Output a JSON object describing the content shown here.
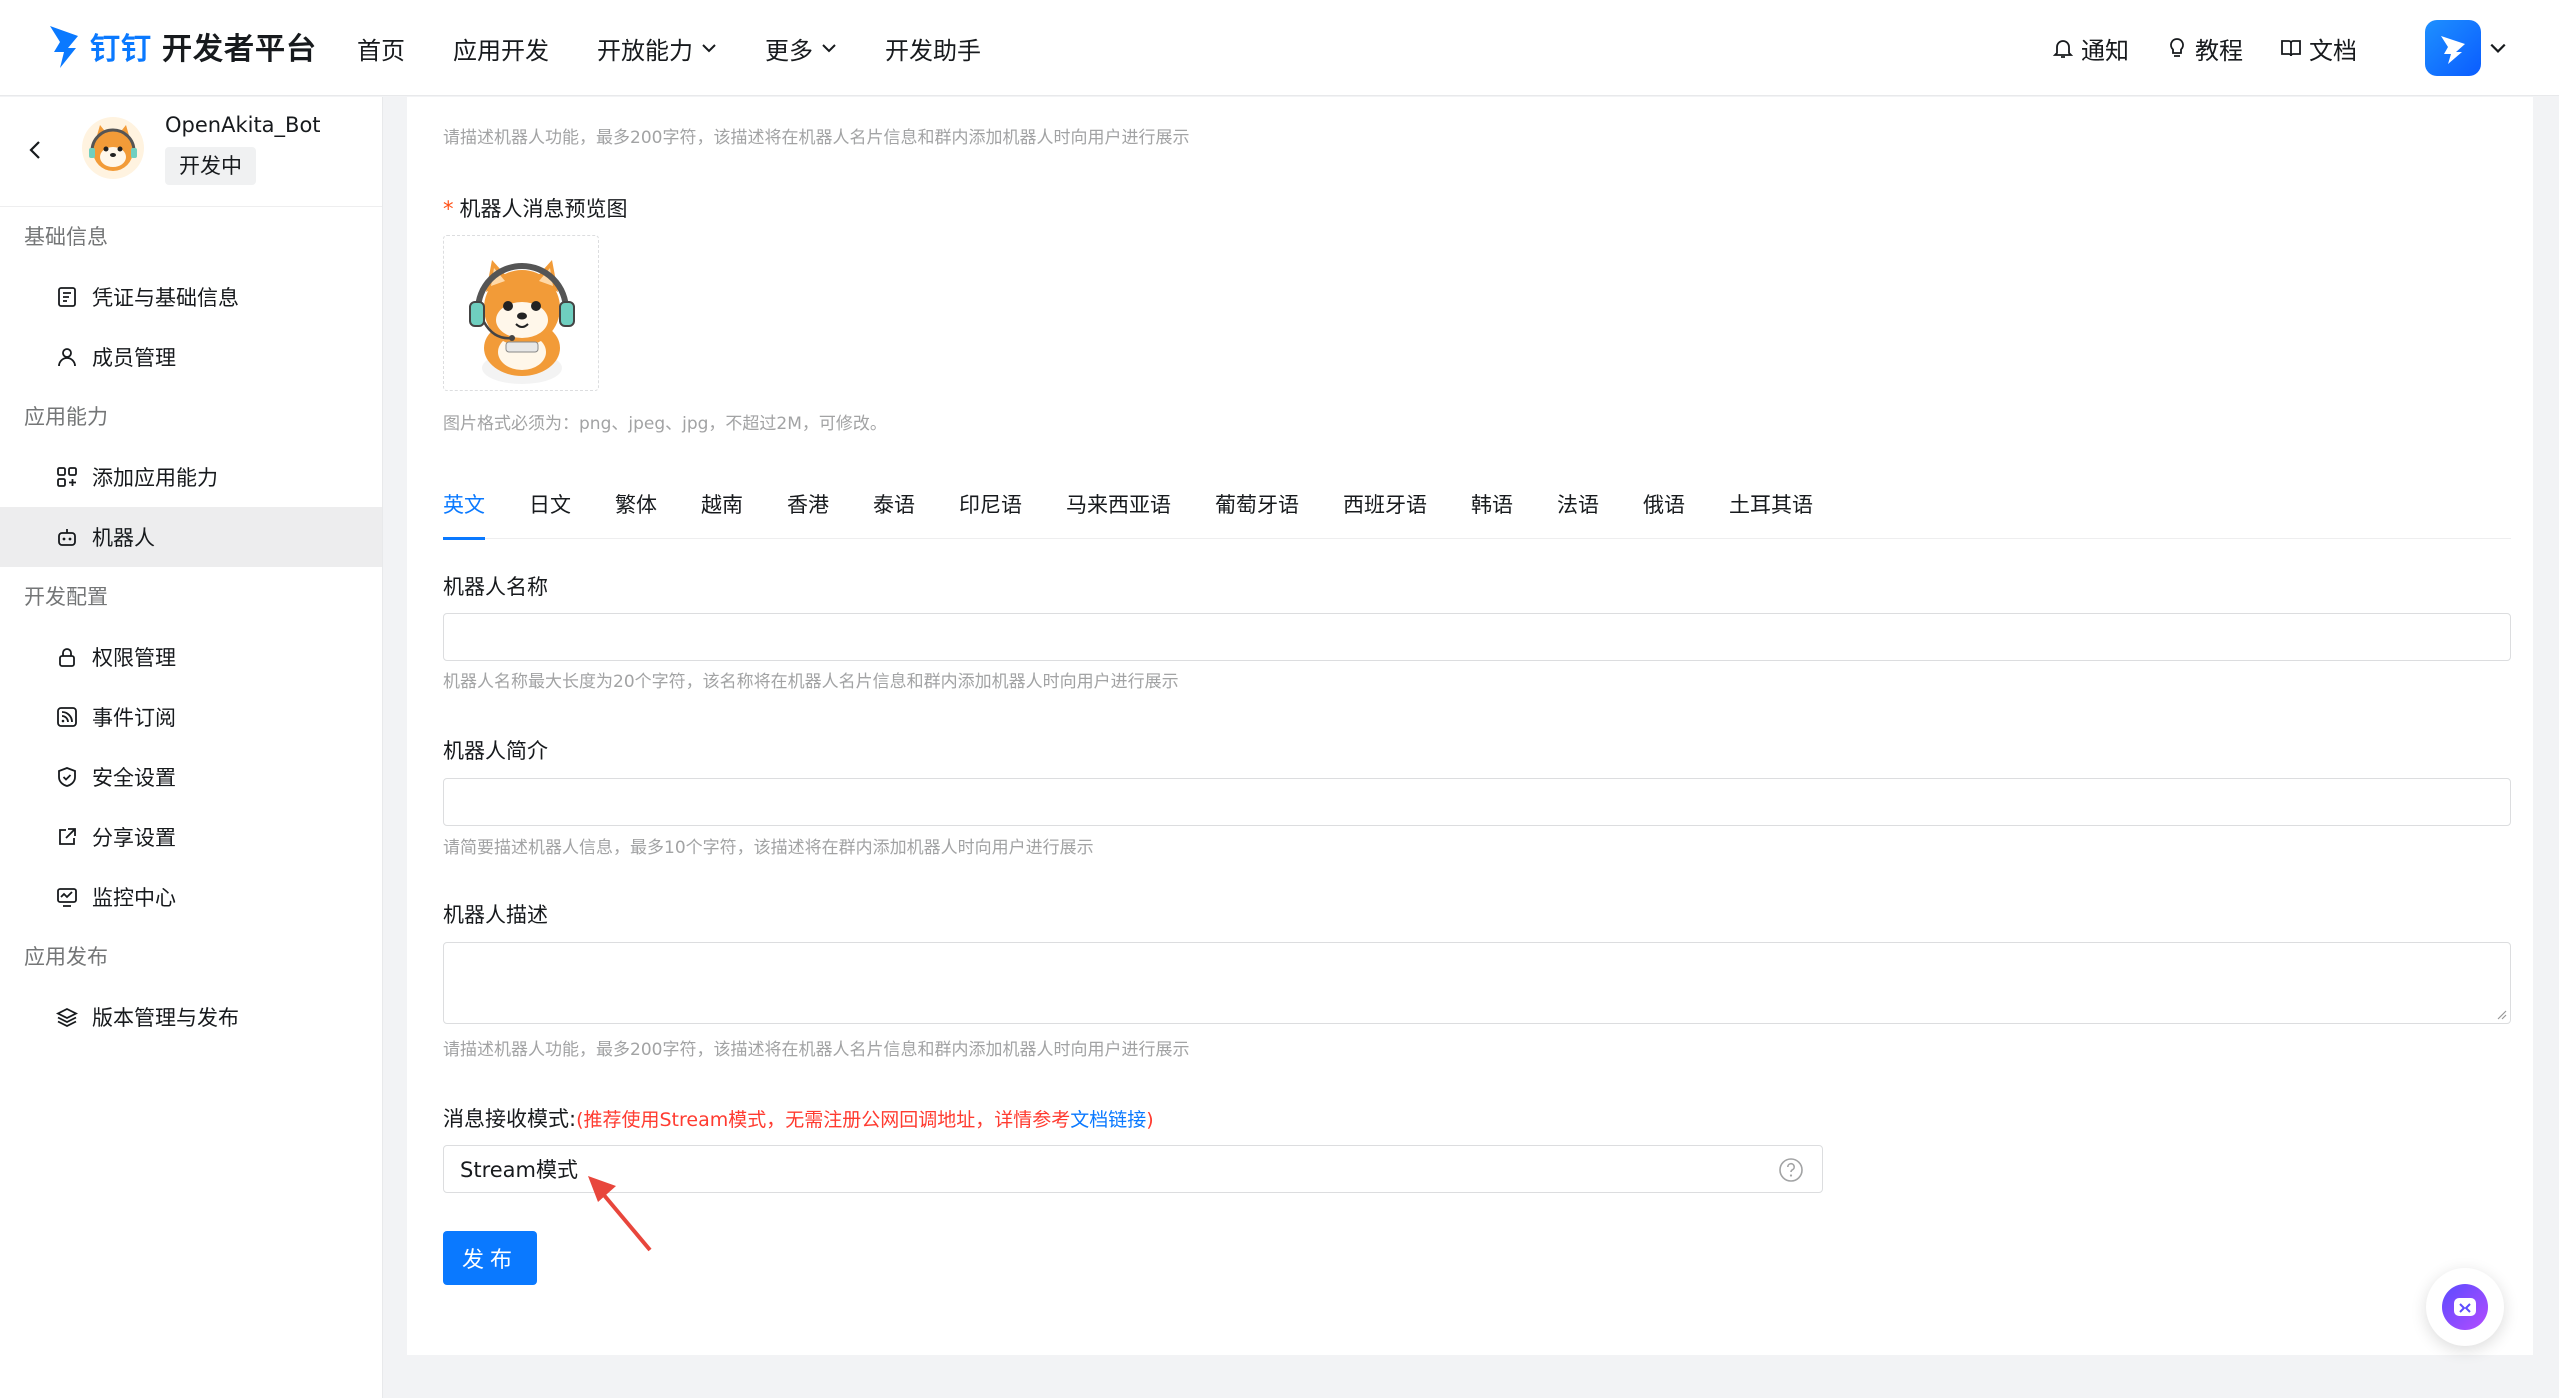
{
  "header": {
    "brand": "钉钉",
    "brand_sub": "开发者平台",
    "nav": [
      "首页",
      "应用开发",
      "开放能力",
      "更多",
      "开发助手"
    ],
    "right": {
      "notify": "通知",
      "tutorial": "教程",
      "docs": "文档"
    }
  },
  "sidebar": {
    "app_name": "OpenAkita_Bot",
    "app_status": "开发中",
    "groups": {
      "basic": "基础信息",
      "ability": "应用能力",
      "dev": "开发配置",
      "release": "应用发布"
    },
    "items": {
      "credentials": "凭证与基础信息",
      "members": "成员管理",
      "add_ability": "添加应用能力",
      "robot": "机器人",
      "permissions": "权限管理",
      "events": "事件订阅",
      "security": "安全设置",
      "share": "分享设置",
      "monitor": "监控中心",
      "versions": "版本管理与发布"
    }
  },
  "main": {
    "top_hint": "请描述机器人功能，最多200字符，该描述将在机器人名片信息和群内添加机器人时向用户进行展示",
    "preview_label": "机器人消息预览图",
    "preview_hint": "图片格式必须为：png、jpeg、jpg，不超过2M，可修改。",
    "tabs": [
      "英文",
      "日文",
      "繁体",
      "越南",
      "香港",
      "泰语",
      "印尼语",
      "马来西亚语",
      "葡萄牙语",
      "西班牙语",
      "韩语",
      "法语",
      "俄语",
      "土耳其语"
    ],
    "name_label": "机器人名称",
    "name_value": "",
    "name_hint": "机器人名称最大长度为20个字符，该名称将在机器人名片信息和群内添加机器人时向用户进行展示",
    "intro_label": "机器人简介",
    "intro_value": "",
    "intro_hint": "请简要描述机器人信息，最多10个字符，该描述将在群内添加机器人时向用户进行展示",
    "desc_label": "机器人描述",
    "desc_value": "",
    "desc_hint": "请描述机器人功能，最多200字符，该描述将在机器人名片信息和群内添加机器人时向用户进行展示",
    "mode_label": "消息接收模式:",
    "mode_note_pre": "(推荐使用Stream模式，无需注册公网回调地址，详情参考",
    "mode_note_link": "文档链接",
    "mode_note_post": ")",
    "mode_value": "Stream模式",
    "publish": "发布"
  },
  "colors": {
    "accent": "#0a79ff",
    "warning": "#ff3b30"
  }
}
